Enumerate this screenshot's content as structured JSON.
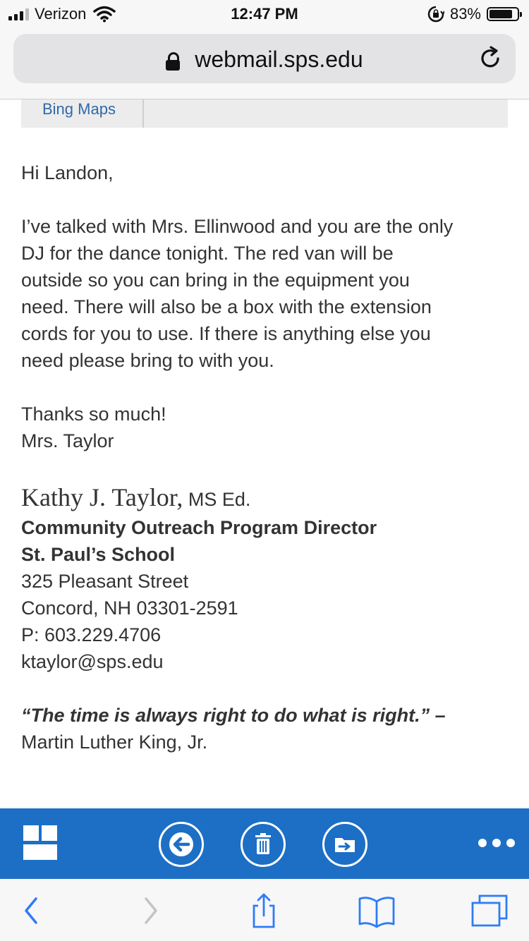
{
  "status_bar": {
    "carrier": "Verizon",
    "time": "12:47 PM",
    "battery_percent": "83%",
    "battery_level": 0.83
  },
  "browser": {
    "url": "webmail.sps.edu"
  },
  "maps_strip": {
    "tab_label": "Bing Maps"
  },
  "email": {
    "greeting": "Hi Landon,",
    "body_lines": [
      "I’ve talked with Mrs. Ellinwood and you are the only",
      "DJ for the dance tonight.  The red van will be",
      "outside so you can bring in the equipment you",
      "need.  There will also be a box with the extension",
      "cords for you to use.  If there is anything else you",
      "need please bring to with you."
    ],
    "closing": "Thanks so much!",
    "closing_name": "Mrs. Taylor",
    "signature": {
      "name": "Kathy J. Taylor,",
      "credential": "MS Ed.",
      "title": "Community Outreach Program Director",
      "school": "St. Paul’s School",
      "street": "325 Pleasant Street",
      "city": "Concord, NH  03301-2591",
      "phone": "P: 603.229.4706",
      "email": "ktaylor@sps.edu",
      "quote": "“The time is always right to do what is right.” –",
      "quote_author": "Martin Luther King, Jr."
    }
  },
  "toolbar": {
    "icons": [
      "app-grid-icon",
      "reply-icon",
      "trash-icon",
      "move-icon",
      "more-icon"
    ],
    "color": "#1c6fc5"
  },
  "safari_bar": {
    "icons": [
      "back-icon",
      "forward-icon",
      "share-icon",
      "bookmarks-icon",
      "tabs-icon"
    ],
    "accent": "#2f7cf6"
  }
}
